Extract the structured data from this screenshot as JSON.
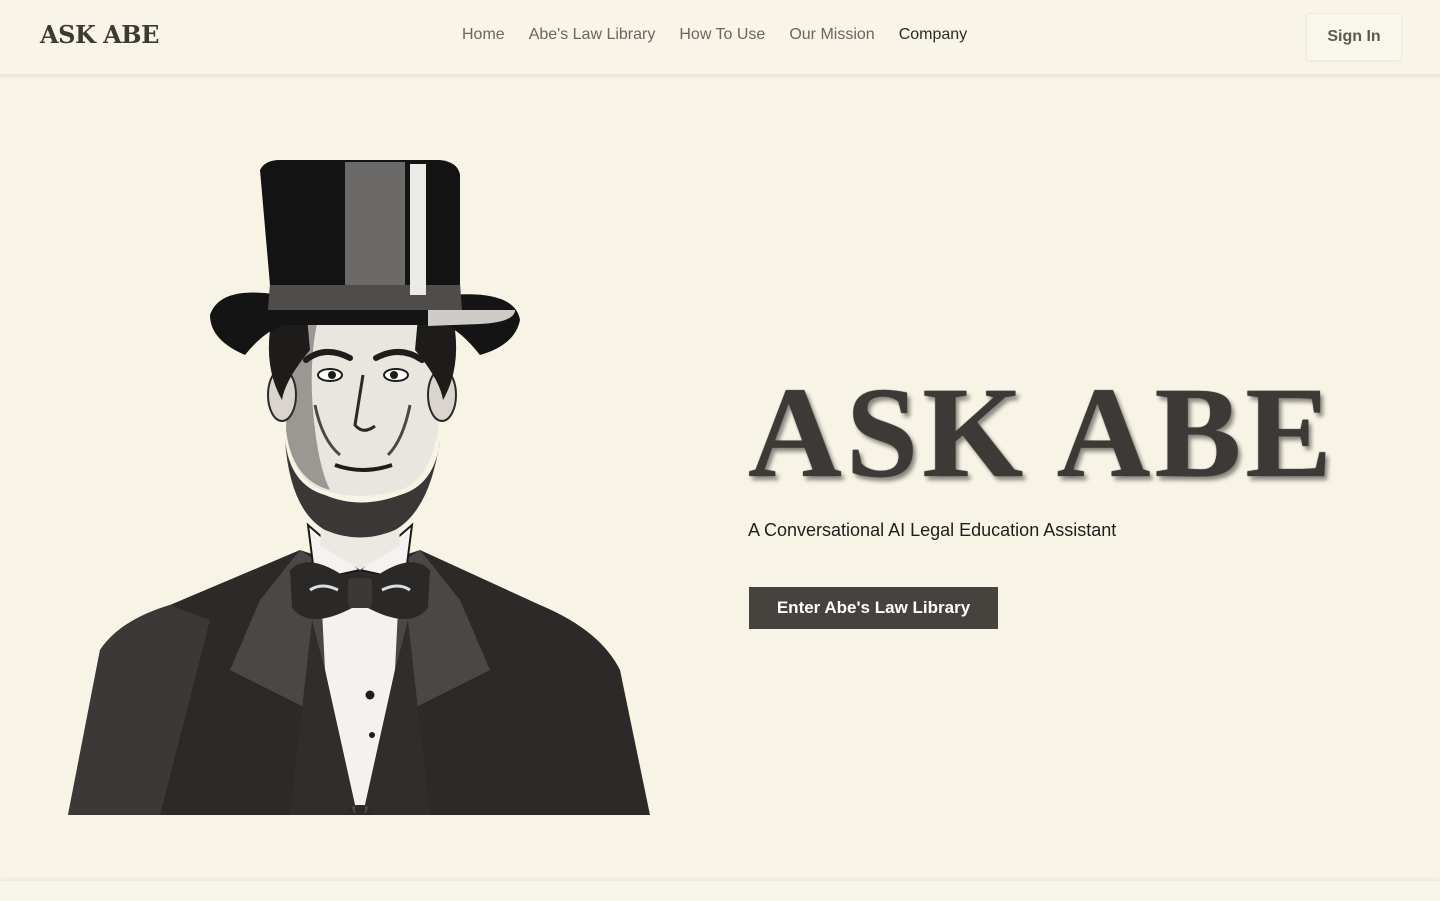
{
  "header": {
    "logo": "ASK ABE",
    "nav": [
      "Home",
      "Abe's Law Library",
      "How To Use",
      "Our Mission",
      "Company"
    ],
    "signin_label": "Sign In"
  },
  "hero": {
    "illustration_icon": "abraham-lincoln-portrait-icon",
    "title": "ASK ABE",
    "subtitle": "A Conversational AI Legal Education Assistant",
    "cta_label": "Enter Abe's Law Library"
  },
  "colors": {
    "background": "#f7f3e5",
    "text_dark": "#3b3a37",
    "button": "#46433f",
    "nav_text": "#6b6660"
  }
}
